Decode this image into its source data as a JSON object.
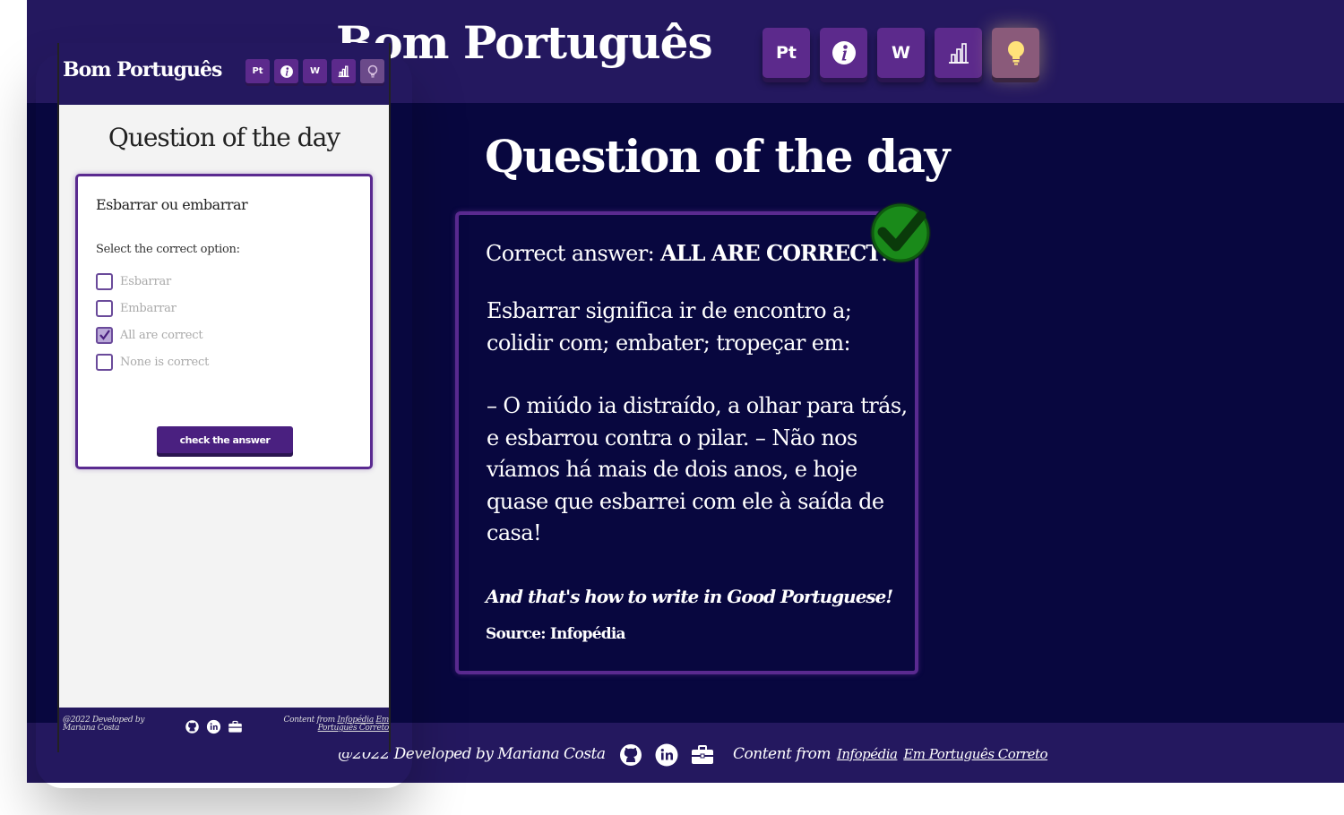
{
  "brand": "Bom Português",
  "nav": [
    {
      "label": "Pt",
      "icon": "pt-text-icon"
    },
    {
      "label": "",
      "icon": "info-icon"
    },
    {
      "label": "W",
      "icon": "w-text-icon"
    },
    {
      "label": "",
      "icon": "bar-chart-icon"
    },
    {
      "label": "",
      "icon": "lightbulb-icon"
    }
  ],
  "desktop": {
    "page_title": "Question of the day",
    "answer": {
      "prefix": "Correct answer: ",
      "value": "ALL ARE CORRECT",
      "suffix": ".",
      "explanation": "Esbarrar significa ir de encontro a; colidir com; embater; tropeçar em:",
      "example": "– O miúdo ia distraído, a olhar para trás, e esbarrou contra o pilar. – Não nos víamos há mais de dois anos, e hoje quase que esbarrei com ele à saída de casa!",
      "motto": "And that's how to write in Good Portuguese!",
      "source": "Source: Infopédia"
    }
  },
  "mobile": {
    "page_title": "Question of the day",
    "question": "Esbarrar ou embarrar",
    "prompt": "Select the correct option:",
    "options": [
      {
        "label": "Esbarrar",
        "checked": false
      },
      {
        "label": "Embarrar",
        "checked": false
      },
      {
        "label": "All are correct",
        "checked": true
      },
      {
        "label": "None is correct",
        "checked": false
      }
    ],
    "check_button": "check the answer"
  },
  "footer": {
    "credit": "@2022 Developed by Mariana Costa",
    "content_prefix": "Content from",
    "link1": "Infopédia",
    "link2": "Em Português Correto",
    "icons": [
      "github-icon",
      "linkedin-icon",
      "briefcase-icon"
    ]
  },
  "colors": {
    "header": "#24185f",
    "background": "#08073f",
    "accent": "#5c2a8c",
    "check_green": "#1a9a1a"
  }
}
